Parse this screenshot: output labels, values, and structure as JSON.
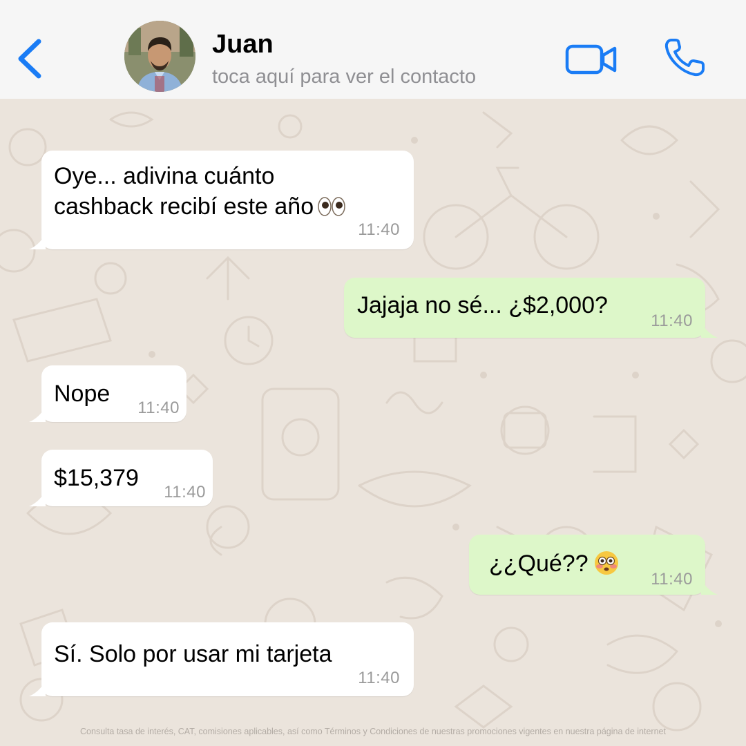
{
  "header": {
    "contact_name": "Juan",
    "contact_subtitle": "toca aquí para ver el contacto",
    "back_icon": "chevron-left-icon",
    "video_icon": "video-camera-icon",
    "call_icon": "phone-icon",
    "accent_color": "#1a7cf5"
  },
  "messages": [
    {
      "direction": "incoming",
      "line1": "Oye... adivina cuánto",
      "line2": "cashback recibí este año",
      "emoji": "eyes-emoji",
      "time": "11:40"
    },
    {
      "direction": "outgoing",
      "text": "Jajaja no sé... ¿$2,000?",
      "time": "11:40"
    },
    {
      "direction": "incoming",
      "text": "Nope",
      "time": "11:40"
    },
    {
      "direction": "incoming",
      "text": "$15,379",
      "time": "11:40"
    },
    {
      "direction": "outgoing",
      "text": "¿¿Qué??",
      "emoji": "flushed-face-emoji",
      "time": "11:40"
    },
    {
      "direction": "incoming",
      "text": "Sí. Solo por usar mi tarjeta",
      "time": "11:40"
    }
  ],
  "colors": {
    "incoming_bubble": "#ffffff",
    "outgoing_bubble": "#ddf7c9",
    "chat_background": "#ebe4dc",
    "header_background": "#f6f6f6"
  },
  "footer": {
    "disclaimer": "Consulta tasa de interés, CAT, comisiones aplicables, así como Términos y Condiciones de nuestras promociones vigentes en nuestra página de internet"
  }
}
